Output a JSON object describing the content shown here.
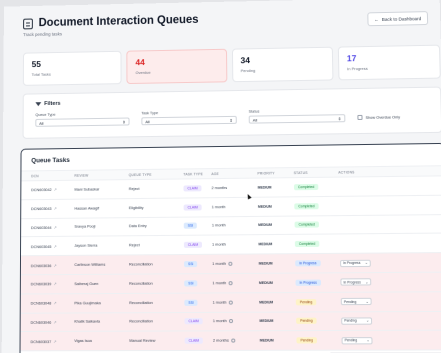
{
  "header": {
    "title": "Document Interaction Queues",
    "subtitle": "Track pending tasks",
    "back_label": "Back to Dashboard",
    "back_icon": "arrow-left-icon"
  },
  "stats": [
    {
      "value": "55",
      "label": "Total Tasks"
    },
    {
      "value": "44",
      "label": "Overdue"
    },
    {
      "value": "34",
      "label": "Pending"
    },
    {
      "value": "17",
      "label": "In Progress"
    }
  ],
  "filters": {
    "title": "Filters",
    "queue_type": {
      "label": "Queue Type",
      "value": "All"
    },
    "task_type": {
      "label": "Task Type",
      "value": "All"
    },
    "status": {
      "label": "Status",
      "value": "All"
    },
    "overdue_only_label": "Show Overdue Only"
  },
  "tasks": {
    "title": "Queue Tasks",
    "columns": [
      "DCN",
      "Review",
      "Queue Type",
      "Task Type",
      "Age",
      "Priority",
      "Status",
      "Actions"
    ],
    "rows": [
      {
        "dcn": "DCN603042",
        "review": "Mani Subaskar",
        "queue": "Reject",
        "task_type": "CLAIM",
        "age": "2 months",
        "priority": "MEDIUM",
        "status": "Completed",
        "action": "",
        "overdue": false
      },
      {
        "dcn": "DCN603043",
        "review": "Hassan Awagif",
        "queue": "Eligibility",
        "task_type": "CLAIM",
        "age": "1 month",
        "priority": "MEDIUM",
        "status": "Completed",
        "action": "",
        "overdue": false
      },
      {
        "dcn": "DCN603044",
        "review": "Sravya Pooji",
        "queue": "Data Entry",
        "task_type": "SSI",
        "age": "1 month",
        "priority": "MEDIUM",
        "status": "Completed",
        "action": "",
        "overdue": false
      },
      {
        "dcn": "DCN603045",
        "review": "Jayson Sierra",
        "queue": "Reject",
        "task_type": "CLAIM",
        "age": "1 month",
        "priority": "MEDIUM",
        "status": "Completed",
        "action": "",
        "overdue": false
      },
      {
        "dcn": "DCN603036",
        "review": "Carlinson Williams",
        "queue": "Reconciliation",
        "task_type": "SSI",
        "age": "1 month",
        "priority": "MEDIUM",
        "status": "In Progress",
        "action": "In Progress",
        "overdue": true
      },
      {
        "dcn": "DCN603039",
        "review": "Saiberaj Guen",
        "queue": "Reconciliation",
        "task_type": "SSI",
        "age": "1 month",
        "priority": "MEDIUM",
        "status": "In Progress",
        "action": "In Progress",
        "overdue": true
      },
      {
        "dcn": "DCN603048",
        "review": "Pika Guujimaka",
        "queue": "Reconciliation",
        "task_type": "SSI",
        "age": "1 month",
        "priority": "MEDIUM",
        "status": "Pending",
        "action": "Pending",
        "overdue": true
      },
      {
        "dcn": "DCN603046",
        "review": "Khalik Saikavla",
        "queue": "Reconciliation",
        "task_type": "CLAIM",
        "age": "1 month",
        "priority": "MEDIUM",
        "status": "Pending",
        "action": "Pending",
        "overdue": true
      },
      {
        "dcn": "DCN603037",
        "review": "Vigas Isoa",
        "queue": "Manual Review",
        "task_type": "CLAIM",
        "age": "2 months",
        "priority": "MEDIUM",
        "status": "Pending",
        "action": "Pending",
        "overdue": true
      }
    ]
  },
  "colors": {
    "overdue_red": "#dc2626",
    "progress_indigo": "#4f46e5",
    "completed_green": "#15803d"
  }
}
